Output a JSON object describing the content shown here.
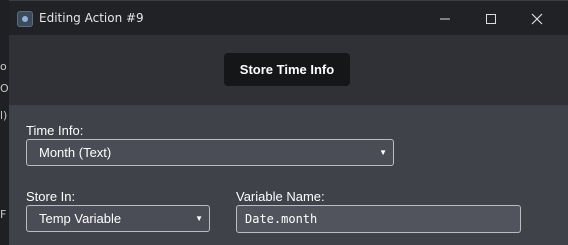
{
  "window": {
    "title": "Editing Action #9",
    "minimize_icon": "minimize-icon",
    "maximize_icon": "maximize-icon",
    "close_icon": "close-icon"
  },
  "action": {
    "button_label": "Store Time Info"
  },
  "form": {
    "time_info": {
      "label": "Time Info:",
      "value": "Month (Text)"
    },
    "store_in": {
      "label": "Store In:",
      "value": "Temp Variable"
    },
    "variable_name": {
      "label": "Variable Name:",
      "value": "Date.month"
    }
  },
  "background_fragments": [
    "o",
    "O",
    "l)",
    "F"
  ],
  "colors": {
    "titlebar": "#202225",
    "header": "#2f3136",
    "content": "#3f4249",
    "button": "#151617",
    "field_border": "#b9bcc2"
  }
}
